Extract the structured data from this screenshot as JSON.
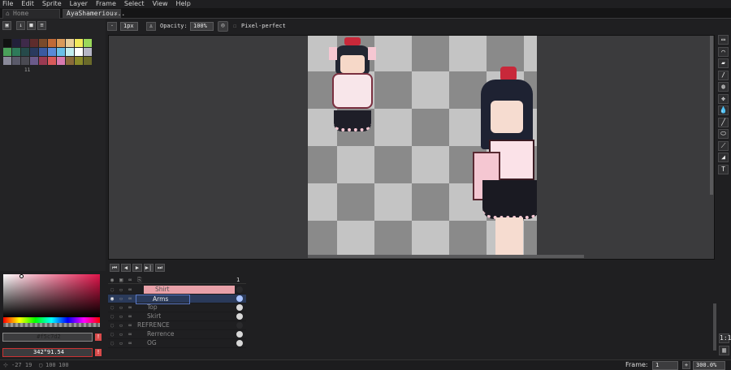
{
  "menu": [
    "File",
    "Edit",
    "Sprite",
    "Layer",
    "Frame",
    "Select",
    "View",
    "Help"
  ],
  "tabs": {
    "home": "Home",
    "active": "AyaShameriou..."
  },
  "palette": {
    "colors": [
      "#111111",
      "#22203a",
      "#3f2a4a",
      "#5e2c2c",
      "#7a4a2a",
      "#c06a38",
      "#d99a5a",
      "#e8cf9a",
      "#f2ea5a",
      "#9ad85a",
      "#4aa05a",
      "#2e7a5a",
      "#264a4a",
      "#2a3a5e",
      "#3a5aa0",
      "#5a8ad8",
      "#6ac0e8",
      "#c2eef0",
      "#ffffff",
      "#b6b6c6",
      "#8a8a9a",
      "#5a5a6a",
      "#4a4a52",
      "#6a5a8a",
      "#9a3a52",
      "#d85a5a",
      "#d87ab0",
      "#8a6a3a",
      "#8a8a2a",
      "#6a6a2a"
    ],
    "extra_count": "11"
  },
  "color_picker": {
    "hex_label": "#f5c7d2",
    "hsv_label": "342°91.54",
    "fg": "#f5c7d2",
    "bg": "#a3143a"
  },
  "top_toolbar": {
    "brush_size": "1px",
    "opacity_label": "Opacity:",
    "opacity_value": "100%",
    "pixel_perfect": "Pixel-perfect"
  },
  "tools": [
    "▭",
    "⌒",
    "▰",
    "/",
    "◍",
    "✥",
    "💧",
    "╱",
    "⬭",
    "⟋",
    "◢",
    "T"
  ],
  "timeline": {
    "frame_number": "1",
    "layers": [
      {
        "name": "Shirt",
        "type": "group-child",
        "selected": false,
        "highlight": true
      },
      {
        "name": "Arms",
        "type": "layer",
        "selected": true,
        "highlight": false
      },
      {
        "name": "Top",
        "type": "layer",
        "selected": false,
        "highlight": false
      },
      {
        "name": "Skirt",
        "type": "layer",
        "selected": false,
        "highlight": false
      },
      {
        "name": "REFRENCE",
        "type": "group",
        "selected": false,
        "highlight": false
      },
      {
        "name": "Rerrence",
        "type": "layer",
        "selected": false,
        "highlight": false
      },
      {
        "name": "OG",
        "type": "layer",
        "selected": false,
        "highlight": false
      }
    ]
  },
  "status": {
    "coords": "-27 19",
    "size_w": "100",
    "size_h": "100",
    "frame_label": "Frame:",
    "frame_value": "1",
    "zoom": "300.0%"
  }
}
